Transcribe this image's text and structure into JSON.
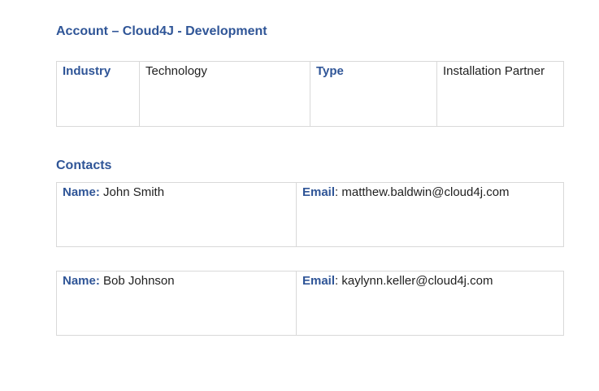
{
  "account": {
    "title": "Account – Cloud4J - Development",
    "industry_label": "Industry",
    "industry_value": "Technology",
    "type_label": "Type",
    "type_value": "Installation Partner"
  },
  "contacts": {
    "heading": "Contacts",
    "name_label": "Name:",
    "email_label": "Email",
    "items": [
      {
        "name": "John Smith",
        "email": "matthew.baldwin@cloud4j.com"
      },
      {
        "name": "Bob Johnson",
        "email": "kaylynn.keller@cloud4j.com"
      }
    ]
  }
}
